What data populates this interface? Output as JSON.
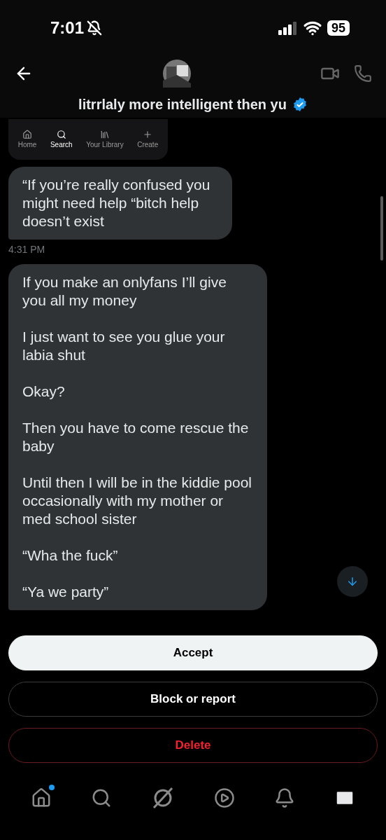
{
  "status_bar": {
    "time": "7:01",
    "silent": true,
    "battery": "95"
  },
  "header": {
    "name": "litrrlaly more intelligent then yu",
    "verified": true
  },
  "shared_image": {
    "nav_items": [
      {
        "label": "Home",
        "selected": false
      },
      {
        "label": "Search",
        "selected": true
      },
      {
        "label": "Your Library",
        "selected": false
      },
      {
        "label": "Create",
        "selected": false
      }
    ]
  },
  "messages": [
    {
      "paragraphs": [
        "“If you’re really confused you might need help “bitch help doesn’t exist"
      ],
      "time": "4:31 PM"
    },
    {
      "paragraphs": [
        "If you make an onlyfans I’ll give you all my money",
        "I just want to see you glue your labia shut",
        "Okay?",
        "Then you have to come rescue the baby",
        "Until then I will be in the kiddie pool occasionally with my mother or med school sister",
        "“Wha the fuck”",
        "“Ya we party”"
      ]
    }
  ],
  "actions": [
    {
      "label": "Accept",
      "kind": "primary"
    },
    {
      "label": "Block or report",
      "kind": "secondary"
    },
    {
      "label": "Delete",
      "kind": "danger"
    }
  ],
  "bottom_nav": [
    {
      "selected": false,
      "badge": true
    },
    {
      "selected": false,
      "badge": false
    },
    {
      "selected": false,
      "badge": false
    },
    {
      "selected": false,
      "badge": false
    },
    {
      "selected": false,
      "badge": false
    },
    {
      "selected": true,
      "badge": false
    }
  ]
}
